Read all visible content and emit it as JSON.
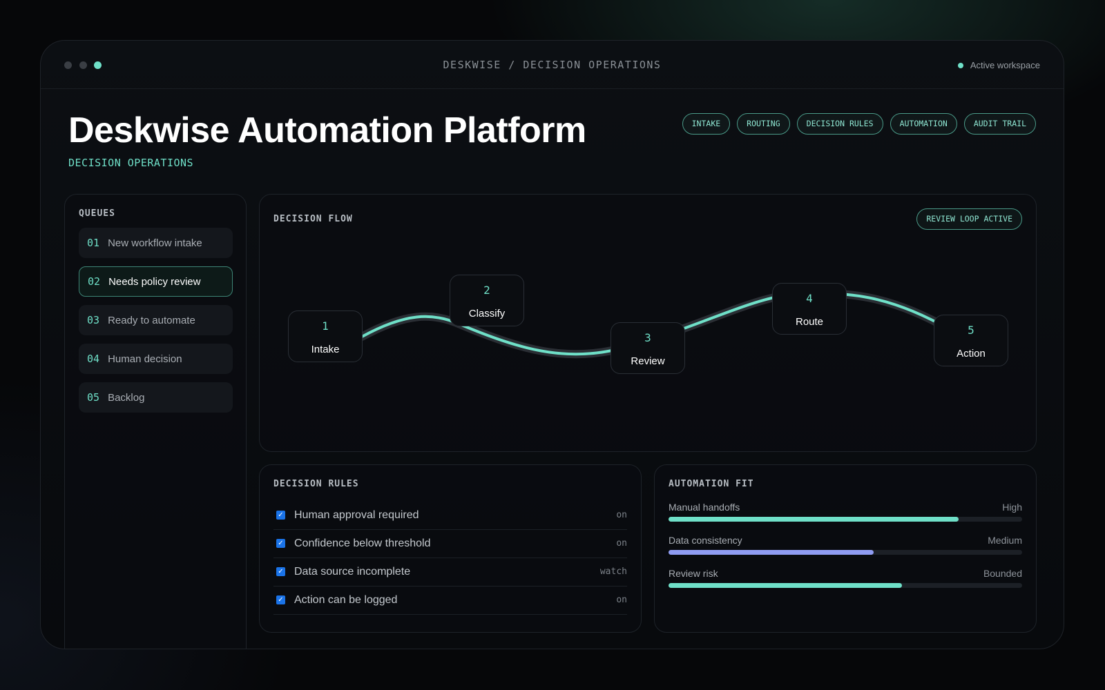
{
  "window": {
    "title": "DESKWISE / DECISION OPERATIONS",
    "workspace": "Active workspace"
  },
  "header": {
    "title": "Deskwise Automation Platform",
    "subtitle": "DECISION OPERATIONS",
    "tags": [
      "INTAKE",
      "ROUTING",
      "DECISION RULES",
      "AUTOMATION",
      "AUDIT TRAIL"
    ]
  },
  "queues": {
    "label": "QUEUES",
    "items": [
      {
        "num": "01",
        "label": "New workflow intake"
      },
      {
        "num": "02",
        "label": "Needs policy review"
      },
      {
        "num": "03",
        "label": "Ready to automate"
      },
      {
        "num": "04",
        "label": "Human decision"
      },
      {
        "num": "05",
        "label": "Backlog"
      }
    ],
    "selected": "02"
  },
  "flow": {
    "label": "DECISION FLOW",
    "badge": "REVIEW LOOP ACTIVE",
    "nodes": [
      {
        "num": "1",
        "label": "Intake"
      },
      {
        "num": "2",
        "label": "Classify"
      },
      {
        "num": "3",
        "label": "Review"
      },
      {
        "num": "4",
        "label": "Route"
      },
      {
        "num": "5",
        "label": "Action"
      }
    ]
  },
  "rules": {
    "label": "DECISION RULES",
    "items": [
      {
        "label": "Human approval required",
        "state": "on",
        "checked": true
      },
      {
        "label": "Confidence below threshold",
        "state": "on",
        "checked": true
      },
      {
        "label": "Data source incomplete",
        "state": "watch",
        "checked": true
      },
      {
        "label": "Action can be logged",
        "state": "on",
        "checked": true
      }
    ]
  },
  "fit": {
    "label": "AUTOMATION FIT",
    "items": [
      {
        "label": "Manual handoffs",
        "level": "High",
        "fraction": 0.82,
        "color": "#6fe0c8"
      },
      {
        "label": "Data consistency",
        "level": "Medium",
        "fraction": 0.58,
        "color": "#8f9cf2"
      },
      {
        "label": "Review risk",
        "level": "Bounded",
        "fraction": 0.66,
        "color": "#6fe0c8"
      }
    ]
  },
  "colors": {
    "accent": "#6fe0c8",
    "secondary": "#8f9cf2",
    "checkbox": "#1a73e8"
  }
}
